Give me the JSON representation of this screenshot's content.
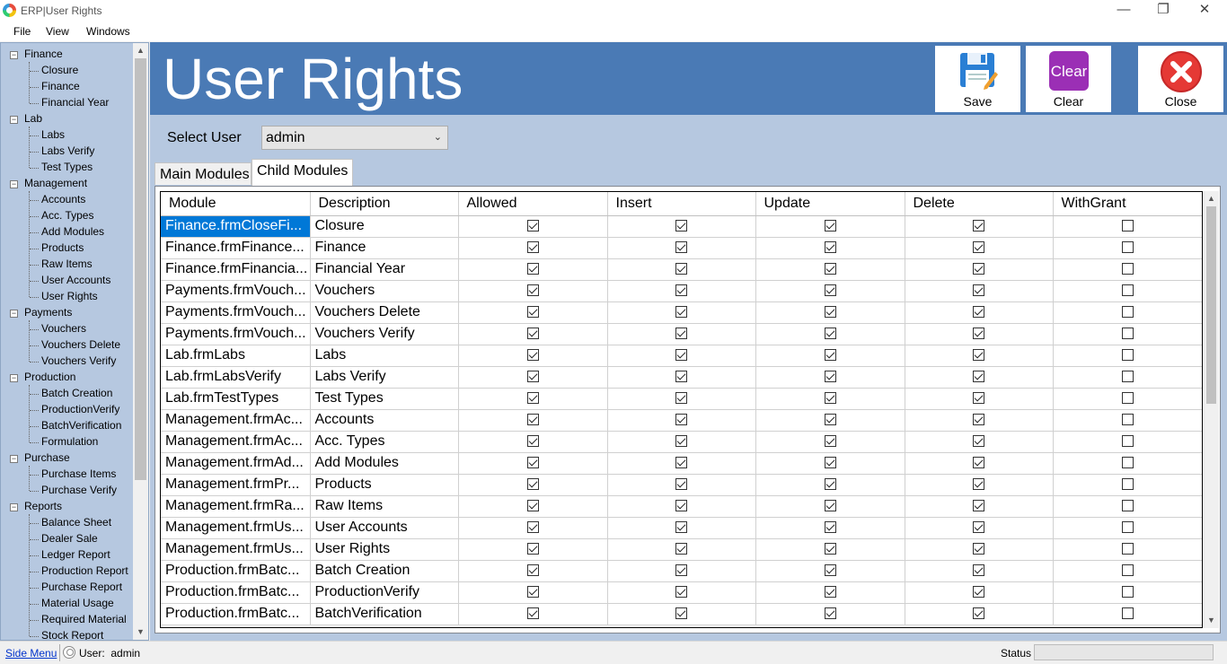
{
  "window": {
    "title": "ERP|User Rights",
    "minimize": "—",
    "maximize": "❐",
    "close": "✕"
  },
  "menu": [
    "File",
    "View",
    "Windows"
  ],
  "tree": [
    {
      "label": "Finance",
      "children": [
        "Closure",
        "Finance",
        "Financial Year"
      ]
    },
    {
      "label": "Lab",
      "children": [
        "Labs",
        "Labs Verify",
        "Test Types"
      ]
    },
    {
      "label": "Management",
      "children": [
        "Accounts",
        "Acc. Types",
        "Add Modules",
        "Products",
        "Raw Items",
        "User Accounts",
        "User Rights"
      ]
    },
    {
      "label": "Payments",
      "children": [
        "Vouchers",
        "Vouchers Delete",
        "Vouchers Verify"
      ]
    },
    {
      "label": "Production",
      "children": [
        "Batch Creation",
        "ProductionVerify",
        "BatchVerification",
        "Formulation"
      ]
    },
    {
      "label": "Purchase",
      "children": [
        "Purchase Items",
        "Purchase Verify"
      ]
    },
    {
      "label": "Reports",
      "children": [
        "Balance Sheet",
        "Dealer Sale",
        "Ledger Report",
        "Production Report",
        "Purchase Report",
        "Material Usage",
        "Required Material",
        "Stock Report"
      ]
    }
  ],
  "header": {
    "title": "User Rights",
    "save_label": "Save",
    "clear_label": "Clear",
    "close_label": "Close",
    "clear_icon_text": "Clear"
  },
  "select_user": {
    "label": "Select User",
    "value": "admin"
  },
  "tabs": [
    "Main Modules",
    "Child Modules"
  ],
  "active_tab": "Child Modules",
  "grid": {
    "columns": [
      "Module",
      "Description",
      "Allowed",
      "Insert",
      "Update",
      "Delete",
      "WithGrant"
    ],
    "rows": [
      {
        "module": "Finance.frmCloseFi...",
        "description": "Closure",
        "allowed": true,
        "insert": true,
        "update": true,
        "delete": true,
        "withgrant": false
      },
      {
        "module": "Finance.frmFinance...",
        "description": "Finance",
        "allowed": true,
        "insert": true,
        "update": true,
        "delete": true,
        "withgrant": false
      },
      {
        "module": "Finance.frmFinancia...",
        "description": "Financial Year",
        "allowed": true,
        "insert": true,
        "update": true,
        "delete": true,
        "withgrant": false
      },
      {
        "module": "Payments.frmVouch...",
        "description": "Vouchers",
        "allowed": true,
        "insert": true,
        "update": true,
        "delete": true,
        "withgrant": false
      },
      {
        "module": "Payments.frmVouch...",
        "description": "Vouchers Delete",
        "allowed": true,
        "insert": true,
        "update": true,
        "delete": true,
        "withgrant": false
      },
      {
        "module": "Payments.frmVouch...",
        "description": "Vouchers Verify",
        "allowed": true,
        "insert": true,
        "update": true,
        "delete": true,
        "withgrant": false
      },
      {
        "module": "Lab.frmLabs",
        "description": "Labs",
        "allowed": true,
        "insert": true,
        "update": true,
        "delete": true,
        "withgrant": false
      },
      {
        "module": "Lab.frmLabsVerify",
        "description": "Labs Verify",
        "allowed": true,
        "insert": true,
        "update": true,
        "delete": true,
        "withgrant": false
      },
      {
        "module": "Lab.frmTestTypes",
        "description": "Test Types",
        "allowed": true,
        "insert": true,
        "update": true,
        "delete": true,
        "withgrant": false
      },
      {
        "module": "Management.frmAc...",
        "description": "Accounts",
        "allowed": true,
        "insert": true,
        "update": true,
        "delete": true,
        "withgrant": false
      },
      {
        "module": "Management.frmAc...",
        "description": "Acc. Types",
        "allowed": true,
        "insert": true,
        "update": true,
        "delete": true,
        "withgrant": false
      },
      {
        "module": "Management.frmAd...",
        "description": "Add Modules",
        "allowed": true,
        "insert": true,
        "update": true,
        "delete": true,
        "withgrant": false
      },
      {
        "module": "Management.frmPr...",
        "description": "Products",
        "allowed": true,
        "insert": true,
        "update": true,
        "delete": true,
        "withgrant": false
      },
      {
        "module": "Management.frmRa...",
        "description": "Raw Items",
        "allowed": true,
        "insert": true,
        "update": true,
        "delete": true,
        "withgrant": false
      },
      {
        "module": "Management.frmUs...",
        "description": "User Accounts",
        "allowed": true,
        "insert": true,
        "update": true,
        "delete": true,
        "withgrant": false
      },
      {
        "module": "Management.frmUs...",
        "description": "User Rights",
        "allowed": true,
        "insert": true,
        "update": true,
        "delete": true,
        "withgrant": false
      },
      {
        "module": "Production.frmBatc...",
        "description": "Batch Creation",
        "allowed": true,
        "insert": true,
        "update": true,
        "delete": true,
        "withgrant": false
      },
      {
        "module": "Production.frmBatc...",
        "description": "ProductionVerify",
        "allowed": true,
        "insert": true,
        "update": true,
        "delete": true,
        "withgrant": false
      },
      {
        "module": "Production.frmBatc...",
        "description": "BatchVerification",
        "allowed": true,
        "insert": true,
        "update": true,
        "delete": true,
        "withgrant": false
      }
    ]
  },
  "statusbar": {
    "side_menu": "Side Menu",
    "user_label": "User:",
    "user_value": "admin",
    "status_label": "Status"
  },
  "colors": {
    "header_bg": "#4a7ab5",
    "panel_bg": "#b6c8e0",
    "selection": "#0078d7",
    "clear_icon": "#9b2fb5",
    "close_icon": "#e53935"
  }
}
